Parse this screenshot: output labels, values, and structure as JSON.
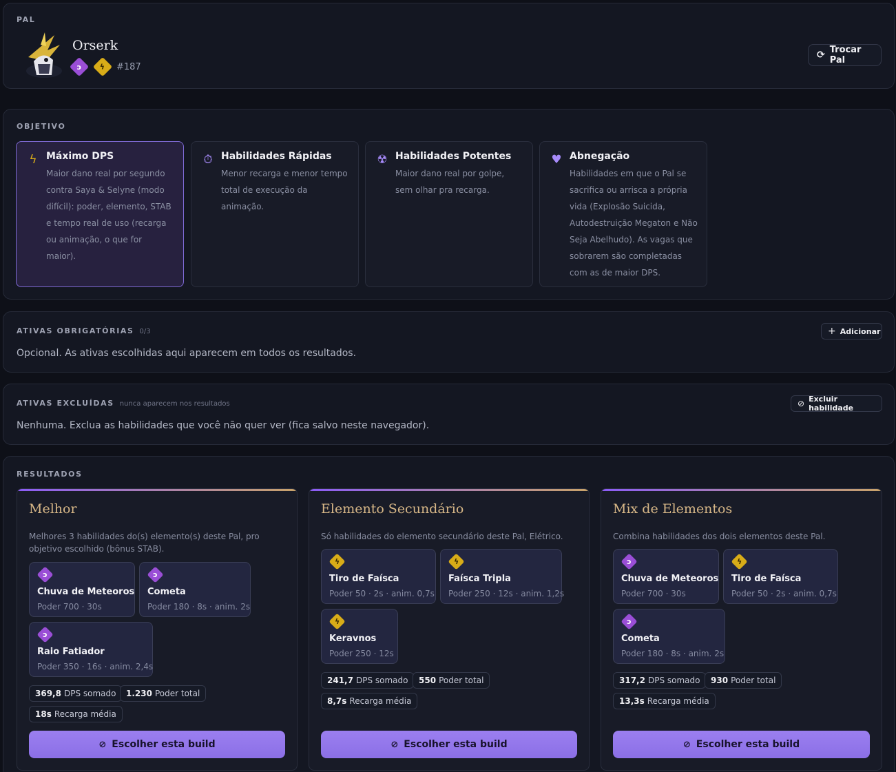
{
  "pal": {
    "section_label": "PAL",
    "name": "Orserk",
    "number": "#187",
    "elements": [
      {
        "name": "dragon",
        "icon": "dragon-element-icon",
        "color": "#9a4ed6"
      },
      {
        "name": "electric",
        "icon": "electric-element-icon",
        "color": "#d8ac18"
      }
    ],
    "change_button": "Trocar Pal"
  },
  "objective": {
    "section_label": "OBJETIVO",
    "selected": 0,
    "options": [
      {
        "title": "Máximo DPS",
        "icon": "lightning-icon",
        "desc": "Maior dano real por segundo contra Saya & Selyne (modo difícil): poder, elemento, STAB e tempo real de uso (recarga ou animação, o que for maior)."
      },
      {
        "title": "Habilidades Rápidas",
        "icon": "stopwatch-icon",
        "desc": "Menor recarga e menor tempo total de execução da animação."
      },
      {
        "title": "Habilidades Potentes",
        "icon": "radiation-icon",
        "desc": "Maior dano real por golpe, sem olhar pra recarga."
      },
      {
        "title": "Abnegação",
        "icon": "broken-heart-icon",
        "desc": "Habilidades em que o Pal se sacrifica ou arrisca a própria vida (Explosão Suicida, Autodestruição Megaton e Não Seja Abelhudo). As vagas que sobrarem são completadas com as de maior DPS."
      }
    ]
  },
  "required": {
    "section_label": "ATIVAS OBRIGATÓRIAS",
    "count": "0/3",
    "add_button": "Adicionar",
    "help": "Opcional. As ativas escolhidas aqui aparecem em todos os resultados."
  },
  "excluded": {
    "section_label": "ATIVAS EXCLUÍDAS",
    "sub": "nunca aparecem nos resultados",
    "button": "Excluir habilidade",
    "help": "Nenhuma. Exclua as habilidades que você não quer ver (fica salvo neste navegador)."
  },
  "results": {
    "section_label": "RESULTADOS",
    "choose_label": "Escolher esta build",
    "builds": [
      {
        "title": "Melhor",
        "desc": "Melhores 3 habilidades do(s) elemento(s) deste Pal, pro objetivo escolhido (bônus STAB).",
        "skills": [
          {
            "name": "Chuva de Meteoros",
            "stats": "Poder 700 · 30s",
            "element": "dragon"
          },
          {
            "name": "Cometa",
            "stats": "Poder 180 · 8s · anim. 2s",
            "element": "dragon"
          },
          {
            "name": "Raio Fatiador",
            "stats": "Poder 350 · 16s · anim. 2,4s",
            "element": "dragon"
          }
        ],
        "stats": [
          {
            "value": "369,8",
            "label": "DPS somado"
          },
          {
            "value": "1.230",
            "label": "Poder total"
          },
          {
            "value": "18s",
            "label": "Recarga média"
          }
        ]
      },
      {
        "title": "Elemento Secundário",
        "desc": "Só habilidades do elemento secundário deste Pal, Elétrico.",
        "skills": [
          {
            "name": "Tiro de Faísca",
            "stats": "Poder 50 · 2s · anim. 0,7s",
            "element": "electric"
          },
          {
            "name": "Faísca Tripla",
            "stats": "Poder 250 · 12s · anim. 1,2s",
            "element": "electric"
          },
          {
            "name": "Keravnos",
            "stats": "Poder 250 · 12s",
            "element": "electric"
          }
        ],
        "stats": [
          {
            "value": "241,7",
            "label": "DPS somado"
          },
          {
            "value": "550",
            "label": "Poder total"
          },
          {
            "value": "8,7s",
            "label": "Recarga média"
          }
        ]
      },
      {
        "title": "Mix de Elementos",
        "desc": "Combina habilidades dos dois elementos deste Pal.",
        "skills": [
          {
            "name": "Chuva de Meteoros",
            "stats": "Poder 700 · 30s",
            "element": "dragon"
          },
          {
            "name": "Tiro de Faísca",
            "stats": "Poder 50 · 2s · anim. 0,7s",
            "element": "electric"
          },
          {
            "name": "Cometa",
            "stats": "Poder 180 · 8s · anim. 2s",
            "element": "dragon"
          }
        ],
        "stats": [
          {
            "value": "317,2",
            "label": "DPS somado"
          },
          {
            "value": "930",
            "label": "Poder total"
          },
          {
            "value": "13,3s",
            "label": "Recarga média"
          }
        ]
      }
    ]
  }
}
